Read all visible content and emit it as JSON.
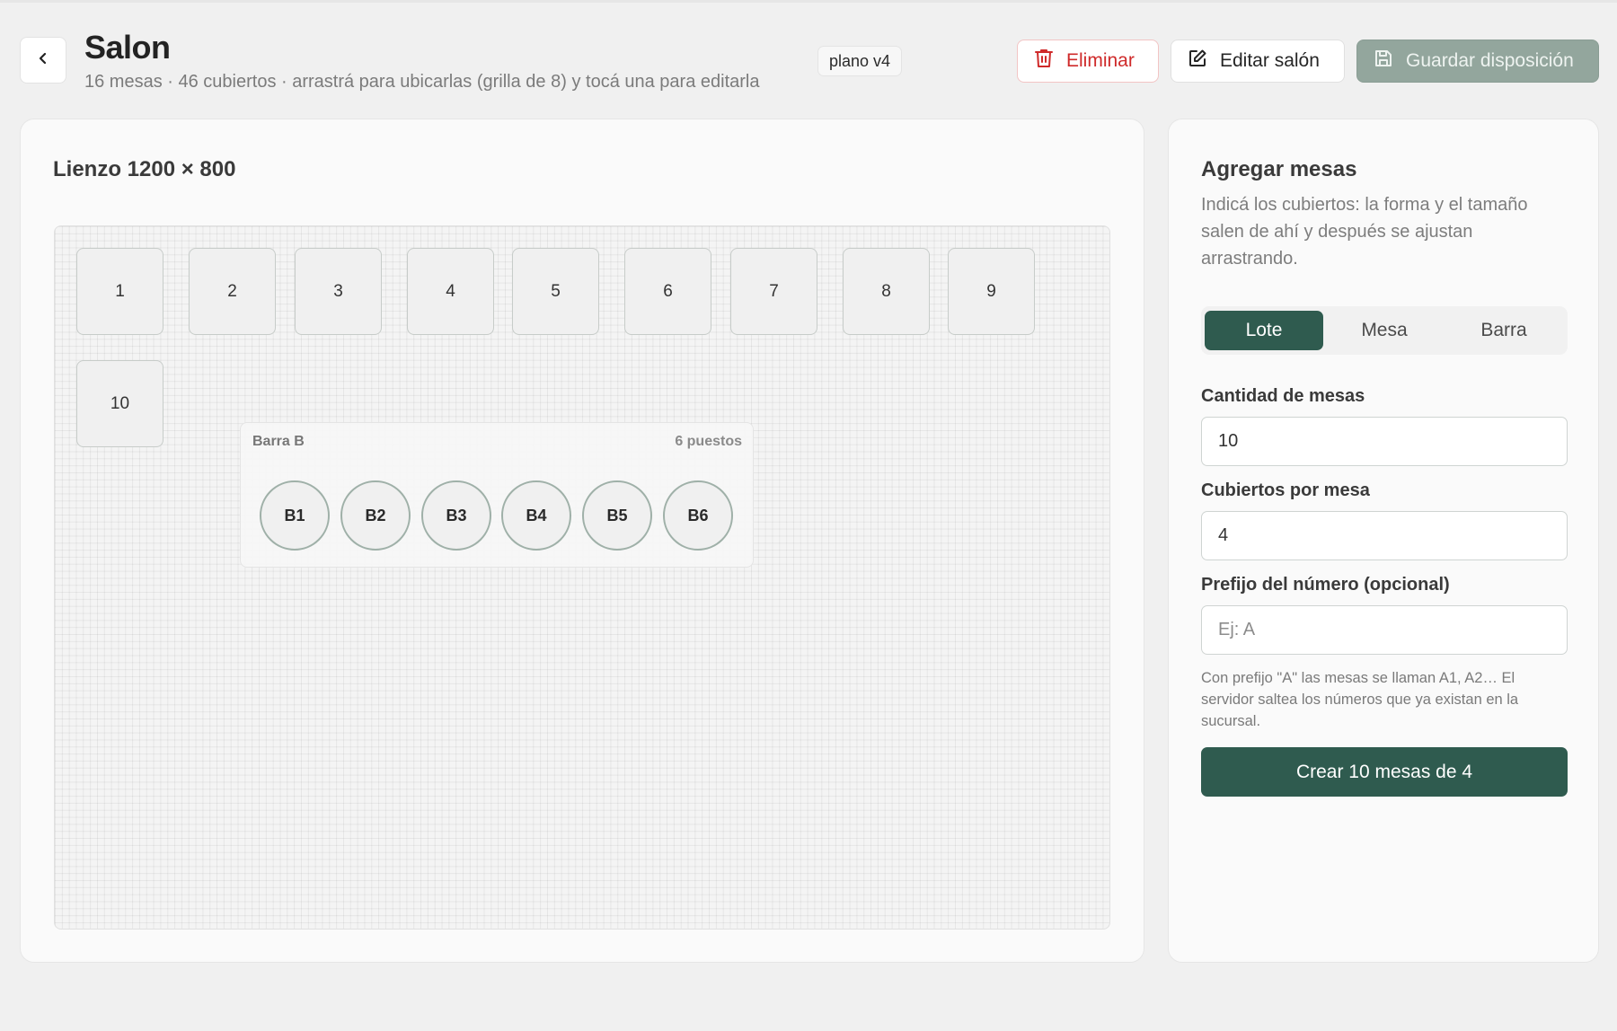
{
  "header": {
    "title": "Salon",
    "subtitle": "16 mesas · 46 cubiertos · arrastrá para ubicarlas (grilla de 8) y tocá una para editarla",
    "plan_badge": "plano v4",
    "delete_label": "Eliminar",
    "edit_label": "Editar salón",
    "save_label": "Guardar disposición"
  },
  "canvas": {
    "title": "Lienzo 1200 × 800",
    "tables": [
      "1",
      "2",
      "3",
      "4",
      "5",
      "6",
      "7",
      "8",
      "9",
      "10"
    ],
    "bar": {
      "name": "Barra B",
      "seats_label": "6 puestos",
      "seats": [
        "B1",
        "B2",
        "B3",
        "B4",
        "B5",
        "B6"
      ]
    }
  },
  "panel": {
    "title": "Agregar mesas",
    "description": "Indicá los cubiertos: la forma y el tamaño salen de ahí y después se ajustan arrastrando.",
    "tabs": [
      {
        "label": "Lote",
        "active": true
      },
      {
        "label": "Mesa",
        "active": false
      },
      {
        "label": "Barra",
        "active": false
      }
    ],
    "quantity_label": "Cantidad de mesas",
    "quantity_value": "10",
    "covers_label": "Cubiertos por mesa",
    "covers_value": "4",
    "prefix_label": "Prefijo del número (opcional)",
    "prefix_value": "",
    "prefix_placeholder": "Ej: A",
    "hint": "Con prefijo \"A\" las mesas se llaman A1, A2… El servidor saltea los números que ya existan en la sucursal.",
    "create_label": "Crear 10 mesas de 4"
  },
  "colors": {
    "primary": "#2f5b4f",
    "danger": "#cf2a2a",
    "save_disabled": "#93a69d",
    "seat_border": "#9fb0a8"
  },
  "icons": {
    "back": "chevron-left-icon",
    "delete": "trash-icon",
    "edit": "edit-icon",
    "save": "floppy-disk-icon"
  }
}
